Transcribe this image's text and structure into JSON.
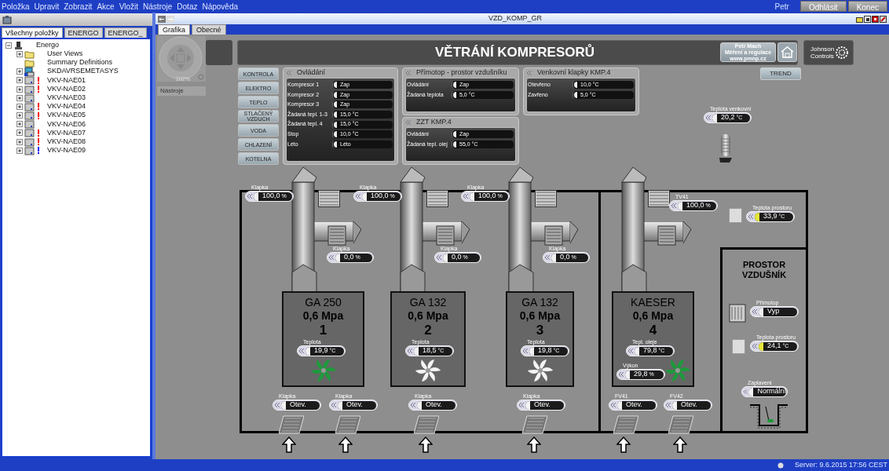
{
  "menu": [
    "Položka",
    "Upravit",
    "Zobrazit",
    "Akce",
    "Vložit",
    "Nástroje",
    "Dotaz",
    "Nápověda"
  ],
  "user": "Petr",
  "header_buttons": [
    "Odhlásit",
    "Konec"
  ],
  "left_panel": {
    "tabs": [
      {
        "label": "Všechny položky",
        "selected": true
      },
      {
        "label": "ENERGO",
        "selected": false
      },
      {
        "label": "ENERGO_",
        "selected": false
      }
    ],
    "tree": [
      {
        "label": "Energo",
        "kind": "site",
        "expanded": true,
        "children": [
          {
            "label": "User Views",
            "kind": "folder",
            "expanded": false
          },
          {
            "label": "Summary Definitions",
            "kind": "folder"
          },
          {
            "label": "SKDAVRSEMETASYS",
            "kind": "server",
            "expanded": false
          },
          {
            "label": "VKV-NAE01",
            "kind": "device",
            "expanded": false,
            "color": "#ff0000"
          },
          {
            "label": "VKV-NAE02",
            "kind": "device",
            "expanded": false,
            "color": "#ff0000"
          },
          {
            "label": "VKV-NAE03",
            "kind": "device",
            "expanded": false
          },
          {
            "label": "VKV-NAE04",
            "kind": "device",
            "expanded": false,
            "color": "#ff0000"
          },
          {
            "label": "VKV-NAE05",
            "kind": "device",
            "expanded": false,
            "color": "#ff0000"
          },
          {
            "label": "VKV-NAE06",
            "kind": "device",
            "expanded": false
          },
          {
            "label": "VKV-NAE07",
            "kind": "device",
            "expanded": false,
            "color": "#ff0000"
          },
          {
            "label": "VKV-NAE08",
            "kind": "device",
            "expanded": false,
            "color": "#ff0000"
          },
          {
            "label": "VKV-NAE09",
            "kind": "device",
            "expanded": false,
            "color": "#0000ff"
          }
        ]
      }
    ]
  },
  "window": {
    "title": "VZD_KOMP_GR",
    "tabs": [
      {
        "label": "Grafika",
        "selected": true
      },
      {
        "label": "Obecné",
        "selected": false
      }
    ]
  },
  "canvas": {
    "zoom": "102%",
    "tools_label": "Nástroje",
    "title": "VĚTRÁNÍ KOMPRESORŮ",
    "credit": [
      "Petr Mach",
      "Měření a regulace",
      "www.pmnp.cz"
    ],
    "brand": [
      "Johnson",
      "Controls"
    ],
    "trend_button": "TREND",
    "nav_buttons": [
      "KONTROLA",
      "ELEKTRO",
      "TEPLO",
      "STLAČENÝ VZDUCH",
      "VODA",
      "CHLAZENÍ",
      "KOTELNA"
    ],
    "panels": [
      {
        "title": "Ovládání",
        "rows": [
          {
            "label": "Kompresor 1",
            "value": "Zap"
          },
          {
            "label": "Kompresor 2",
            "value": "Zap"
          },
          {
            "label": "Kompresor 3",
            "value": "Zap"
          },
          {
            "label": "Žádaná tepl. 1-3",
            "value": "15,0",
            "unit": "°C"
          },
          {
            "label": "Žádaná tepl. 4",
            "value": "15,0",
            "unit": "°C"
          },
          {
            "label": "Stop",
            "value": "10,0",
            "unit": "°C"
          },
          {
            "label": "Léto",
            "value": "Léto"
          }
        ]
      },
      {
        "title": "Přímotop - prostor vzdušníku",
        "rows": [
          {
            "label": "Ovládání",
            "value": "Zap"
          },
          {
            "label": "Žádaná teplota",
            "value": "5,0",
            "unit": "°C"
          }
        ]
      },
      {
        "title": "ZZT KMP.4",
        "rows": [
          {
            "label": "Ovládání",
            "value": "Zap"
          },
          {
            "label": "Žádaná tepl. olej",
            "value": "55,0",
            "unit": "°C"
          }
        ]
      },
      {
        "title": "Venkovní klapky KMP.4",
        "rows": [
          {
            "label": "Otevřeno",
            "value": "10,0",
            "unit": "°C"
          },
          {
            "label": "Zavřeno",
            "value": "5,0",
            "unit": "°C"
          }
        ]
      }
    ],
    "readouts": [
      {
        "label": "Teplota venkovní",
        "value": "20,2",
        "unit": "°C",
        "highlighted": false
      },
      {
        "label": "Klapka",
        "value": "100,0",
        "unit": "%",
        "highlighted": false
      },
      {
        "label": "Klapka",
        "value": "100,0",
        "unit": "%",
        "highlighted": false
      },
      {
        "label": "Klapka",
        "value": "100,0",
        "unit": "%",
        "highlighted": false
      },
      {
        "label": "TV41",
        "value": "100,0",
        "unit": "%",
        "highlighted": false
      },
      {
        "label": "Teplota prostoru",
        "value": "33,9",
        "unit": "°C",
        "highlighted": true
      },
      {
        "label": "Klapka",
        "value": "0,0",
        "unit": "%",
        "highlighted": false
      },
      {
        "label": "Klapka",
        "value": "0,0",
        "unit": "%",
        "highlighted": false
      },
      {
        "label": "Klapka",
        "value": "0,0",
        "unit": "%",
        "highlighted": false
      },
      {
        "label": "Přímotop",
        "value": "Vyp",
        "highlighted": false
      },
      {
        "label": "Teplota prostoru",
        "value": "24,1",
        "unit": "°C",
        "highlighted": true
      },
      {
        "label": "Zaplavení",
        "value": "Normální",
        "highlighted": false
      },
      {
        "label": "Klapka",
        "value": "Otev.",
        "highlighted": false
      },
      {
        "label": "Klapka",
        "value": "Otev.",
        "highlighted": false
      },
      {
        "label": "Klapka",
        "value": "Otev.",
        "highlighted": false
      },
      {
        "label": "Klapka",
        "value": "Otev.",
        "highlighted": false
      },
      {
        "label": "FV41",
        "value": "Otev.",
        "highlighted": false
      },
      {
        "label": "FV42",
        "value": "Otev.",
        "highlighted": false
      }
    ],
    "compressors": [
      {
        "model": "GA 250",
        "pressure": "0,6 Mpa",
        "number": "1",
        "fan_running": true,
        "readouts": [
          {
            "label": "Teplota",
            "value": "19,9",
            "unit": "°C"
          }
        ]
      },
      {
        "model": "GA 132",
        "pressure": "0,6 Mpa",
        "number": "2",
        "fan_running": false,
        "readouts": [
          {
            "label": "Teplota",
            "value": "18,5",
            "unit": "°C"
          }
        ]
      },
      {
        "model": "GA 132",
        "pressure": "0,6 Mpa",
        "number": "3",
        "fan_running": false,
        "readouts": [
          {
            "label": "Teplota",
            "value": "19,8",
            "unit": "°C"
          }
        ]
      },
      {
        "model": "KAESER",
        "pressure": "0,6 Mpa",
        "number": "4",
        "fan_running": true,
        "readouts": [
          {
            "label": "Tepl. oleje",
            "value": "79,8",
            "unit": "°C"
          },
          {
            "label": "Výkon",
            "value": "29,8",
            "unit": "%"
          }
        ]
      }
    ],
    "room_title": "PROSTOR VZDUŠNÍK"
  },
  "status_bar": "Server: 9.6.2015 17:56 CEST"
}
